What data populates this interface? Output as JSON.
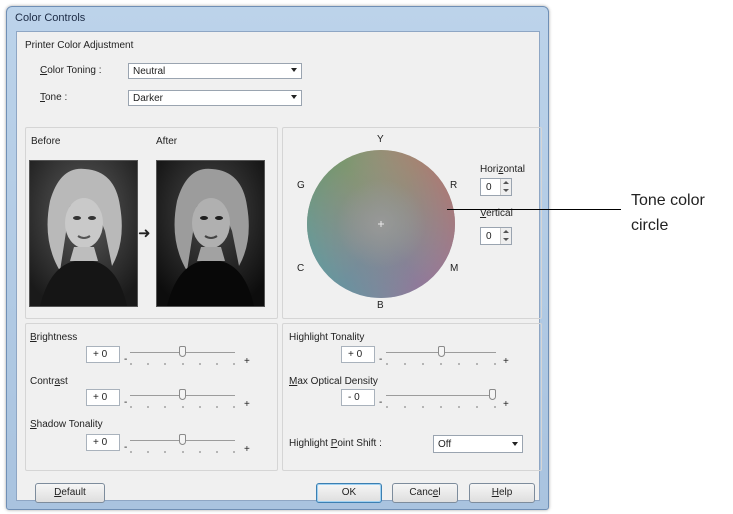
{
  "window": {
    "title": "Color Controls"
  },
  "adjustment": {
    "group_label": "Printer Color Adjustment",
    "color_toning": {
      "label_pre": "",
      "label_key": "C",
      "label_post": "olor Toning :",
      "value": "Neutral"
    },
    "tone": {
      "label_key": "T",
      "label_post": "one :",
      "value": "Darker"
    }
  },
  "preview": {
    "before_label": "Before",
    "after_label": "After",
    "arrow": "➜"
  },
  "color_circle": {
    "labels": {
      "top": "Y",
      "top_right": "R",
      "bottom_right": "M",
      "bottom": "B",
      "bottom_left": "C",
      "top_left": "G"
    },
    "horizontal": {
      "label_pre": "Hori",
      "label_key": "z",
      "label_post": "ontal",
      "value": "0"
    },
    "vertical": {
      "label_key": "V",
      "label_post": "ertical",
      "value": "0"
    }
  },
  "sliders_left": [
    {
      "label_key": "B",
      "label_post": "rightness",
      "value": "+ 0",
      "minus": "-",
      "plus": "+",
      "level": 0.5
    },
    {
      "label_pre": "Contr",
      "label_key": "a",
      "label_post": "st",
      "value": "+ 0",
      "minus": "-",
      "plus": "+",
      "level": 0.5
    },
    {
      "label_key": "S",
      "label_post": "hadow Tonality",
      "value": "+ 0",
      "minus": "-",
      "plus": "+",
      "level": 0.5
    }
  ],
  "sliders_right": [
    {
      "label": "Highlight Tonality",
      "value": "+ 0",
      "minus": "-",
      "plus": "+",
      "level": 0.5
    },
    {
      "label_key": "M",
      "label_post": "ax Optical Density",
      "value": "- 0",
      "minus": "-",
      "plus": "+",
      "level": 1.0
    }
  ],
  "highlight_point_shift": {
    "label_pre": "Highlight ",
    "label_key": "P",
    "label_post": "oint Shift :",
    "value": "Off"
  },
  "buttons": {
    "default": {
      "label_key": "D",
      "label_post": "efault"
    },
    "ok": "OK",
    "cancel": {
      "label_pre": "Canc",
      "label_key": "e",
      "label_post": "l"
    },
    "help": {
      "label_key": "H",
      "label_post": "elp"
    }
  },
  "callout": {
    "line1": "Tone color",
    "line2": "circle"
  },
  "colors": {
    "title_bar": "#bcd3ea",
    "dialog_bg": "#f0f0f0",
    "ok_border": "#3c7fb1"
  }
}
